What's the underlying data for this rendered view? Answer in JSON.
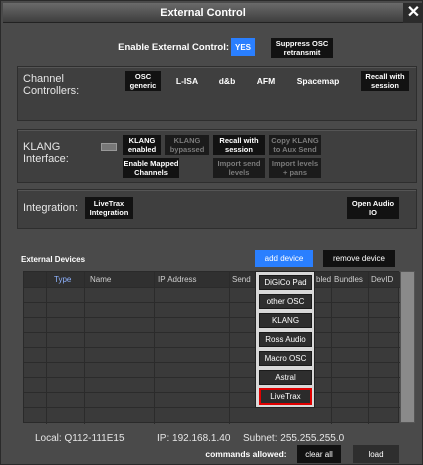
{
  "window": {
    "title": "External Control",
    "close_glyph": "✕"
  },
  "enable": {
    "label": "Enable External Control:",
    "yes_label": "YES",
    "suppress_label": "Suppress OSC retransmit"
  },
  "channel_controllers": {
    "label": "Channel Controllers:",
    "osc_label": "OSC generic",
    "lisa_label": "L-ISA",
    "dnb_label": "d&b",
    "afm_label": "AFM",
    "spacemap_label": "Spacemap",
    "recall_label": "Recall with session"
  },
  "klang": {
    "label": "KLANG Interface:",
    "enabled_label": "KLANG enabled",
    "bypassed_label": "KLANG bypassed",
    "recall_label": "Recall with session",
    "copy_label": "Copy KLANG to Aux Send",
    "mapped_label": "Enable Mapped Channels",
    "import_send_label": "Import send levels",
    "import_levels_label": "Import levels + pans"
  },
  "integration": {
    "label": "Integration:",
    "livetrax_label": "LiveTrax Integration",
    "open_audio_label": "Open Audio IO"
  },
  "external_devices": {
    "label": "External Devices",
    "add_label": "add device",
    "remove_label": "remove device",
    "columns": {
      "type": "Type",
      "name": "Name",
      "ip": "IP Address",
      "send": "Send",
      "enabled": "bled",
      "bundles": "Bundles",
      "devid": "DevID"
    }
  },
  "device_menu": {
    "items": [
      "DiGiCo Pad",
      "other OSC",
      "KLANG",
      "Ross Audio",
      "Macro OSC",
      "Astral",
      "LiveTrax"
    ],
    "highlighted": "LiveTrax"
  },
  "footer": {
    "local": "Local:  Q112-111E15",
    "ip": "IP: 192.168.1.40",
    "subnet": "Subnet: 255.255.255.0",
    "commands_label": "commands allowed:",
    "clear_label": "clear all",
    "load_label": "load"
  },
  "colors": {
    "accent": "#2a7fff",
    "highlight_border": "#e00000",
    "panel": "#3f3f3f"
  }
}
